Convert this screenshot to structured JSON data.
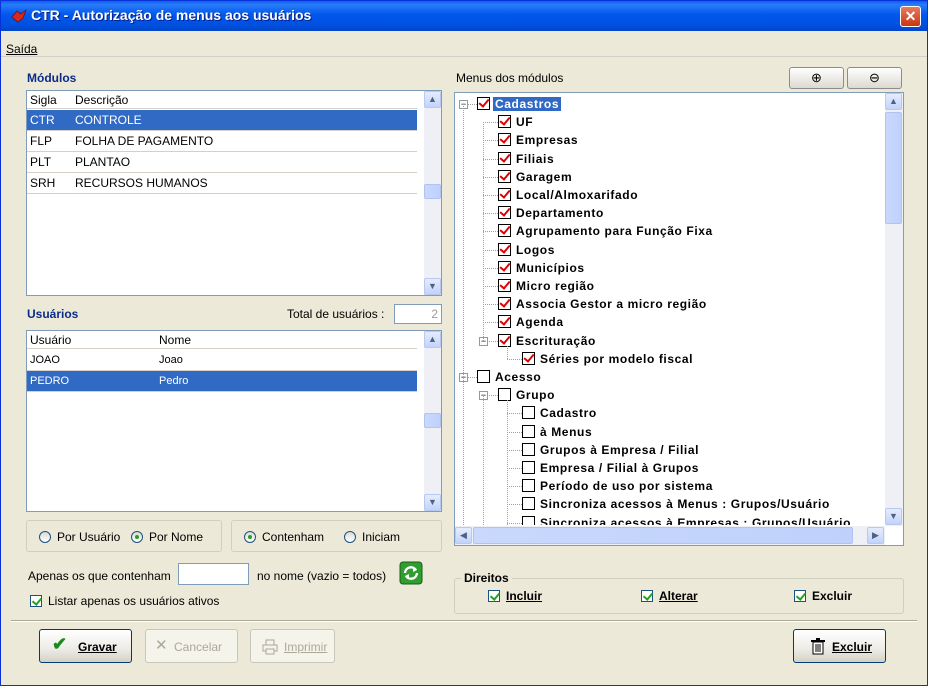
{
  "window": {
    "title": "CTR - Autorização de menus aos usuários",
    "close_glyph": "✕"
  },
  "menubar": {
    "items": [
      "Saída"
    ]
  },
  "modulos": {
    "title": "Módulos",
    "columns": [
      "Sigla",
      "Descrição"
    ],
    "rows": [
      {
        "sigla": "CTR",
        "descricao": "CONTROLE",
        "selected": true
      },
      {
        "sigla": "FLP",
        "descricao": "FOLHA DE PAGAMENTO",
        "selected": false
      },
      {
        "sigla": "PLT",
        "descricao": "PLANTAO",
        "selected": false
      },
      {
        "sigla": "SRH",
        "descricao": "RECURSOS HUMANOS",
        "selected": false
      }
    ]
  },
  "usuarios": {
    "title": "Usuários",
    "total_label": "Total de usuários :",
    "total_value": "2",
    "columns": [
      "Usuário",
      "Nome"
    ],
    "rows": [
      {
        "usuario": "JOAO",
        "nome": "Joao",
        "selected": false
      },
      {
        "usuario": "PEDRO",
        "nome": "Pedro",
        "selected": true
      }
    ]
  },
  "filters": {
    "por_usuario": "Por Usuário",
    "por_nome": "Por Nome",
    "contenham": "Contenham",
    "iniciam": "Iniciam",
    "apenas_label": "Apenas os que contenham",
    "apenas_value": "",
    "nome_hint": "no nome (vazio = todos)",
    "listar_ativos": "Listar apenas os usuários ativos"
  },
  "menus": {
    "title": "Menus dos módulos",
    "zoom_in": "⊕",
    "zoom_out": "⊖",
    "tree": [
      {
        "label": "Cadastros",
        "level": 0,
        "checked": true,
        "expander": "−",
        "selected": true
      },
      {
        "label": "UF",
        "level": 1,
        "checked": true
      },
      {
        "label": "Empresas",
        "level": 1,
        "checked": true
      },
      {
        "label": "Filiais",
        "level": 1,
        "checked": true
      },
      {
        "label": "Garagem",
        "level": 1,
        "checked": true
      },
      {
        "label": "Local/Almoxarifado",
        "level": 1,
        "checked": true
      },
      {
        "label": "Departamento",
        "level": 1,
        "checked": true
      },
      {
        "label": "Agrupamento para Função Fixa",
        "level": 1,
        "checked": true
      },
      {
        "label": "Logos",
        "level": 1,
        "checked": true
      },
      {
        "label": "Municípios",
        "level": 1,
        "checked": true
      },
      {
        "label": "Micro região",
        "level": 1,
        "checked": true
      },
      {
        "label": "Associa Gestor a micro região",
        "level": 1,
        "checked": true
      },
      {
        "label": "Agenda",
        "level": 1,
        "checked": true
      },
      {
        "label": "Escrituração",
        "level": 1,
        "checked": true,
        "expander": "−"
      },
      {
        "label": "Séries por modelo fiscal",
        "level": 2,
        "checked": true
      },
      {
        "label": "Acesso",
        "level": 0,
        "checked": false,
        "expander": "−"
      },
      {
        "label": "Grupo",
        "level": 1,
        "checked": false,
        "expander": "−"
      },
      {
        "label": "Cadastro",
        "level": 2,
        "checked": false
      },
      {
        "label": "à Menus",
        "level": 2,
        "checked": false
      },
      {
        "label": "Grupos à Empresa / Filial",
        "level": 2,
        "checked": false
      },
      {
        "label": "Empresa / Filial à Grupos",
        "level": 2,
        "checked": false
      },
      {
        "label": "Período de uso por sistema",
        "level": 2,
        "checked": false
      },
      {
        "label": "Sincroniza acessos à Menus : Grupos/Usuário",
        "level": 2,
        "checked": false
      },
      {
        "label": "Sincroniza acessos à Empresas : Grupos/Usuário",
        "level": 2,
        "checked": false
      }
    ]
  },
  "direitos": {
    "title": "Direitos",
    "incluir": "Incluir",
    "alterar": "Alterar",
    "excluir": "Excluir"
  },
  "buttons": {
    "gravar": "Gravar",
    "cancelar": "Cancelar",
    "imprimir": "Imprimir",
    "excluir": "Excluir"
  }
}
